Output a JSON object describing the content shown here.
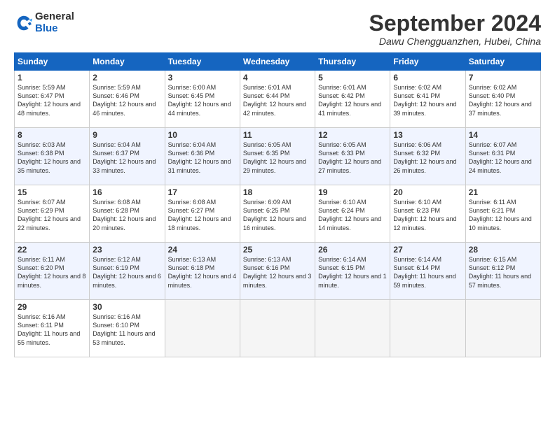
{
  "logo": {
    "general": "General",
    "blue": "Blue"
  },
  "title": "September 2024",
  "location": "Dawu Chengguanzhen, Hubei, China",
  "headers": [
    "Sunday",
    "Monday",
    "Tuesday",
    "Wednesday",
    "Thursday",
    "Friday",
    "Saturday"
  ],
  "weeks": [
    [
      {
        "day": "1",
        "rise": "5:59 AM",
        "set": "6:47 PM",
        "daylight": "12 hours and 48 minutes."
      },
      {
        "day": "2",
        "rise": "5:59 AM",
        "set": "6:46 PM",
        "daylight": "12 hours and 46 minutes."
      },
      {
        "day": "3",
        "rise": "6:00 AM",
        "set": "6:45 PM",
        "daylight": "12 hours and 44 minutes."
      },
      {
        "day": "4",
        "rise": "6:01 AM",
        "set": "6:44 PM",
        "daylight": "12 hours and 42 minutes."
      },
      {
        "day": "5",
        "rise": "6:01 AM",
        "set": "6:42 PM",
        "daylight": "12 hours and 41 minutes."
      },
      {
        "day": "6",
        "rise": "6:02 AM",
        "set": "6:41 PM",
        "daylight": "12 hours and 39 minutes."
      },
      {
        "day": "7",
        "rise": "6:02 AM",
        "set": "6:40 PM",
        "daylight": "12 hours and 37 minutes."
      }
    ],
    [
      {
        "day": "8",
        "rise": "6:03 AM",
        "set": "6:38 PM",
        "daylight": "12 hours and 35 minutes."
      },
      {
        "day": "9",
        "rise": "6:04 AM",
        "set": "6:37 PM",
        "daylight": "12 hours and 33 minutes."
      },
      {
        "day": "10",
        "rise": "6:04 AM",
        "set": "6:36 PM",
        "daylight": "12 hours and 31 minutes."
      },
      {
        "day": "11",
        "rise": "6:05 AM",
        "set": "6:35 PM",
        "daylight": "12 hours and 29 minutes."
      },
      {
        "day": "12",
        "rise": "6:05 AM",
        "set": "6:33 PM",
        "daylight": "12 hours and 27 minutes."
      },
      {
        "day": "13",
        "rise": "6:06 AM",
        "set": "6:32 PM",
        "daylight": "12 hours and 26 minutes."
      },
      {
        "day": "14",
        "rise": "6:07 AM",
        "set": "6:31 PM",
        "daylight": "12 hours and 24 minutes."
      }
    ],
    [
      {
        "day": "15",
        "rise": "6:07 AM",
        "set": "6:29 PM",
        "daylight": "12 hours and 22 minutes."
      },
      {
        "day": "16",
        "rise": "6:08 AM",
        "set": "6:28 PM",
        "daylight": "12 hours and 20 minutes."
      },
      {
        "day": "17",
        "rise": "6:08 AM",
        "set": "6:27 PM",
        "daylight": "12 hours and 18 minutes."
      },
      {
        "day": "18",
        "rise": "6:09 AM",
        "set": "6:25 PM",
        "daylight": "12 hours and 16 minutes."
      },
      {
        "day": "19",
        "rise": "6:10 AM",
        "set": "6:24 PM",
        "daylight": "12 hours and 14 minutes."
      },
      {
        "day": "20",
        "rise": "6:10 AM",
        "set": "6:23 PM",
        "daylight": "12 hours and 12 minutes."
      },
      {
        "day": "21",
        "rise": "6:11 AM",
        "set": "6:21 PM",
        "daylight": "12 hours and 10 minutes."
      }
    ],
    [
      {
        "day": "22",
        "rise": "6:11 AM",
        "set": "6:20 PM",
        "daylight": "12 hours and 8 minutes."
      },
      {
        "day": "23",
        "rise": "6:12 AM",
        "set": "6:19 PM",
        "daylight": "12 hours and 6 minutes."
      },
      {
        "day": "24",
        "rise": "6:13 AM",
        "set": "6:18 PM",
        "daylight": "12 hours and 4 minutes."
      },
      {
        "day": "25",
        "rise": "6:13 AM",
        "set": "6:16 PM",
        "daylight": "12 hours and 3 minutes."
      },
      {
        "day": "26",
        "rise": "6:14 AM",
        "set": "6:15 PM",
        "daylight": "12 hours and 1 minute."
      },
      {
        "day": "27",
        "rise": "6:14 AM",
        "set": "6:14 PM",
        "daylight": "11 hours and 59 minutes."
      },
      {
        "day": "28",
        "rise": "6:15 AM",
        "set": "6:12 PM",
        "daylight": "11 hours and 57 minutes."
      }
    ],
    [
      {
        "day": "29",
        "rise": "6:16 AM",
        "set": "6:11 PM",
        "daylight": "11 hours and 55 minutes."
      },
      {
        "day": "30",
        "rise": "6:16 AM",
        "set": "6:10 PM",
        "daylight": "11 hours and 53 minutes."
      },
      null,
      null,
      null,
      null,
      null
    ]
  ]
}
